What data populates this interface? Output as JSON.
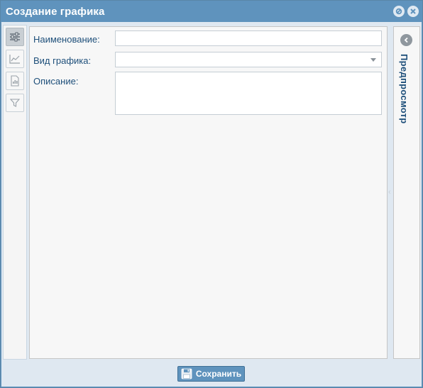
{
  "window": {
    "title": "Создание графика"
  },
  "form": {
    "name_label": "Наименование:",
    "name_value": "",
    "type_label": "Вид графика:",
    "type_value": "",
    "description_label": "Описание:",
    "description_value": ""
  },
  "preview": {
    "label": "Предпросмотр"
  },
  "footer": {
    "save_label": "Сохранить"
  },
  "colors": {
    "titlebar": "#5f93bd",
    "label_text": "#1e4f7a",
    "panel_bg": "#dfe8f1"
  },
  "icons": {
    "left_toolbar": [
      "settings-sliders-icon",
      "line-chart-icon",
      "document-chart-icon",
      "filter-icon"
    ],
    "title_tools": [
      "minimize-icon",
      "close-icon"
    ],
    "preview_toggle": "chevron-left-icon",
    "save": "floppy-disk-icon"
  }
}
